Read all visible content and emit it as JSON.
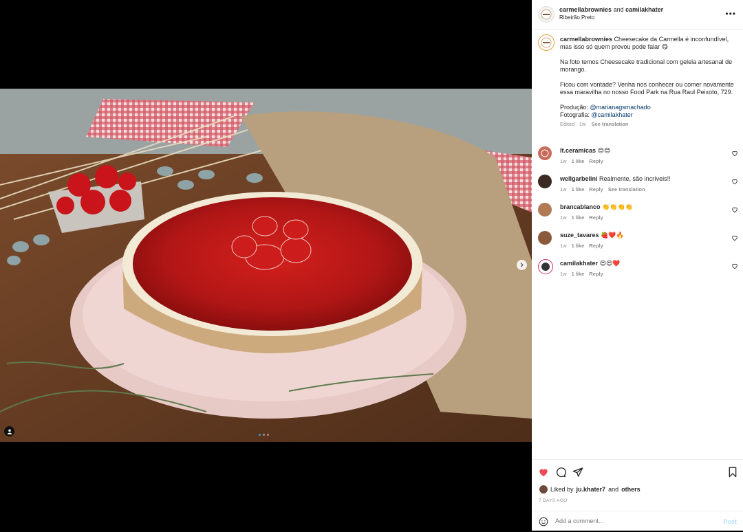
{
  "post": {
    "author": "carmellabrownies",
    "conjunction": "and",
    "coauthor": "camilakhater",
    "location": "Ribeirão Preto",
    "more_icon": "more-horizontal-icon"
  },
  "caption": {
    "author": "carmellabrownies",
    "line1": "Cheesecake da Carmella é inconfundível, mas isso só quem provou pode falar 😋",
    "line2": "Na foto temos Cheesecake tradicional com geleia artesanal de morango.",
    "line3": "Ficou com vontade? Venha nos conhecer ou comer novamente essa maravilha no nosso Food Park na Rua Raul Peixoto, 729.",
    "producao_label": "Produção:",
    "producao_mention": "@marianagsmachado",
    "fotografia_label": "Fotografia:",
    "fotografia_mention": "@camilakhater",
    "edited": "Edited · 1w",
    "see_translation": "See translation"
  },
  "comments": [
    {
      "user": "lt.ceramicas",
      "text": "😊😊",
      "time": "1w",
      "likes": "1 like",
      "reply": "Reply",
      "translate": ""
    },
    {
      "user": "wellgarbelini",
      "text": "Realmente, são incríveis!!",
      "time": "1w",
      "likes": "1 like",
      "reply": "Reply",
      "translate": "See translation"
    },
    {
      "user": "brancablanco",
      "text": "👏👏👏👏",
      "time": "1w",
      "likes": "1 like",
      "reply": "Reply",
      "translate": ""
    },
    {
      "user": "suze_tavares",
      "text": "🍓❤️🔥",
      "time": "1w",
      "likes": "1 like",
      "reply": "Reply",
      "translate": ""
    },
    {
      "user": "camilakhater",
      "text": "😍😍❤️",
      "time": "1w",
      "likes": "1 like",
      "reply": "Reply",
      "translate": ""
    }
  ],
  "actions": {
    "liked_by_prefix": "Liked by",
    "liked_by_user": "ju.khater7",
    "liked_by_and": "and",
    "liked_by_others": "others",
    "timestamp": "7 DAYS AGO",
    "comment_placeholder": "Add a comment...",
    "post_label": "Post"
  },
  "media": {
    "slides": 3,
    "active_slide": 1
  },
  "colors": {
    "like_red": "#ed4956",
    "link_blue": "#00376b",
    "post_disabled": "#b2dffc",
    "dot_active": "#3a96f0"
  }
}
